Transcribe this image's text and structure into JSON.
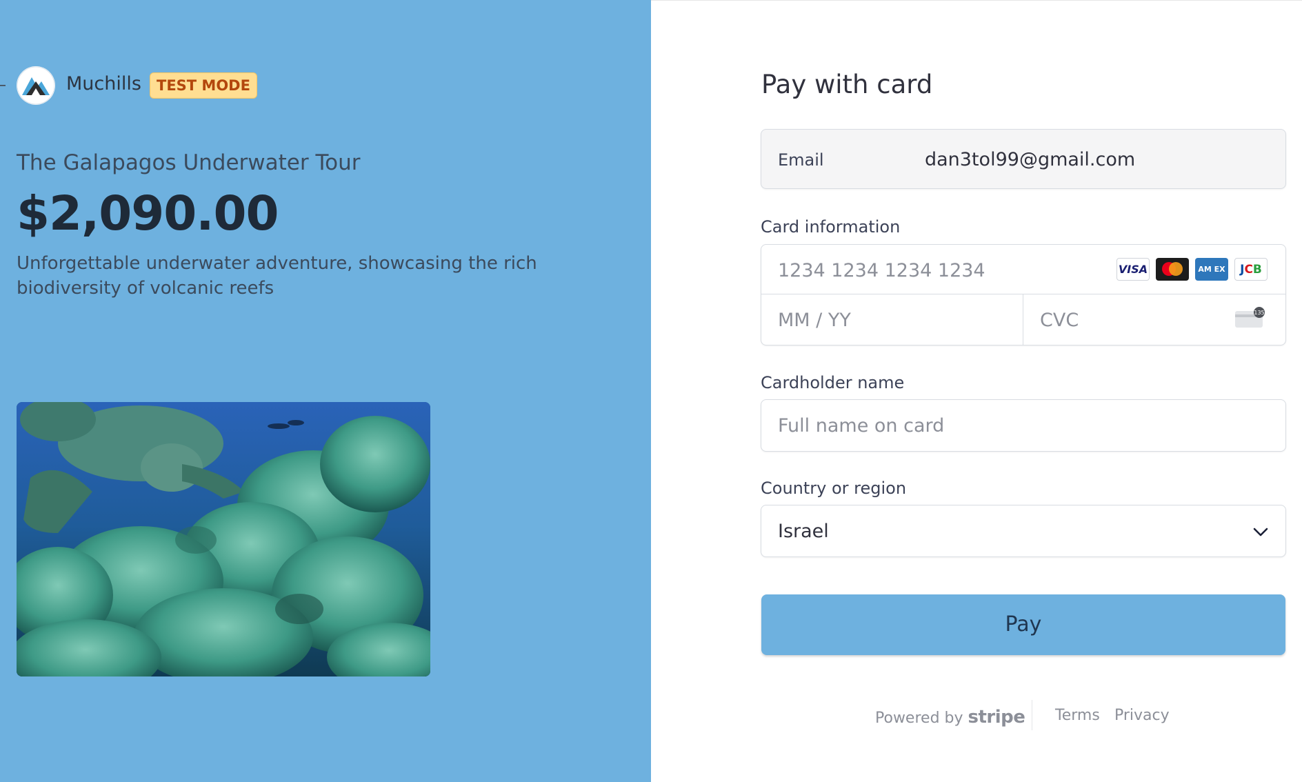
{
  "merchant": {
    "name": "Muchills",
    "test_badge": "TEST MODE"
  },
  "product": {
    "name": "The Galapagos Underwater Tour",
    "price": "$2,090.00",
    "description": "Unforgettable underwater adventure, showcasing the rich biodiversity of volcanic reefs"
  },
  "checkout": {
    "title": "Pay with card",
    "email_label": "Email",
    "email_value": "dan3tol99@gmail.com",
    "card_label": "Card information",
    "card_number_placeholder": "1234 1234 1234 1234",
    "expiry_placeholder": "MM / YY",
    "cvc_placeholder": "CVC",
    "cvc_icon_text": "135",
    "card_brands": [
      "VISA",
      "mastercard",
      "AM EX",
      "JCB"
    ],
    "cardholder_label": "Cardholder name",
    "cardholder_placeholder": "Full name on card",
    "country_label": "Country or region",
    "country_value": "Israel",
    "pay_button": "Pay"
  },
  "footer": {
    "powered_by": "Powered by",
    "stripe": "stripe",
    "terms": "Terms",
    "privacy": "Privacy"
  },
  "colors": {
    "left_background": "#6eb1df",
    "pay_button": "#6eb1df",
    "test_badge_bg": "#ffde92",
    "test_badge_text": "#b3470d"
  },
  "icons": [
    "back-arrow-icon",
    "merchant-logo",
    "visa-icon",
    "mastercard-icon",
    "amex-icon",
    "jcb-icon",
    "cvc-card-icon",
    "chevron-down-icon"
  ]
}
